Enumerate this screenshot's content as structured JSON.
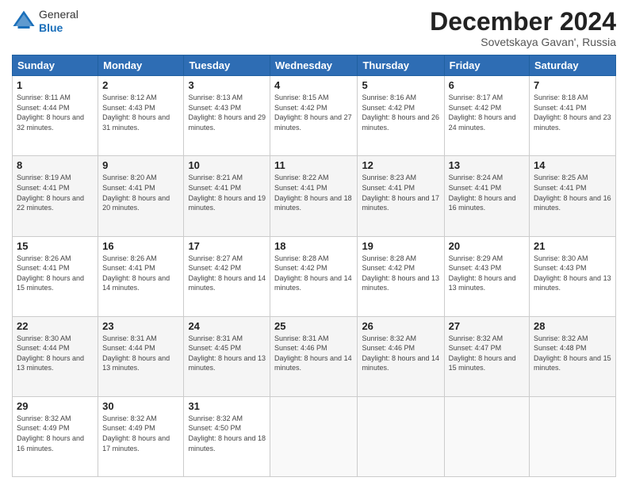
{
  "header": {
    "logo_general": "General",
    "logo_blue": "Blue",
    "month_title": "December 2024",
    "subtitle": "Sovetskaya Gavan', Russia"
  },
  "weekdays": [
    "Sunday",
    "Monday",
    "Tuesday",
    "Wednesday",
    "Thursday",
    "Friday",
    "Saturday"
  ],
  "weeks": [
    [
      {
        "day": "1",
        "sunrise": "8:11 AM",
        "sunset": "4:44 PM",
        "daylight": "8 hours and 32 minutes."
      },
      {
        "day": "2",
        "sunrise": "8:12 AM",
        "sunset": "4:43 PM",
        "daylight": "8 hours and 31 minutes."
      },
      {
        "day": "3",
        "sunrise": "8:13 AM",
        "sunset": "4:43 PM",
        "daylight": "8 hours and 29 minutes."
      },
      {
        "day": "4",
        "sunrise": "8:15 AM",
        "sunset": "4:42 PM",
        "daylight": "8 hours and 27 minutes."
      },
      {
        "day": "5",
        "sunrise": "8:16 AM",
        "sunset": "4:42 PM",
        "daylight": "8 hours and 26 minutes."
      },
      {
        "day": "6",
        "sunrise": "8:17 AM",
        "sunset": "4:42 PM",
        "daylight": "8 hours and 24 minutes."
      },
      {
        "day": "7",
        "sunrise": "8:18 AM",
        "sunset": "4:41 PM",
        "daylight": "8 hours and 23 minutes."
      }
    ],
    [
      {
        "day": "8",
        "sunrise": "8:19 AM",
        "sunset": "4:41 PM",
        "daylight": "8 hours and 22 minutes."
      },
      {
        "day": "9",
        "sunrise": "8:20 AM",
        "sunset": "4:41 PM",
        "daylight": "8 hours and 20 minutes."
      },
      {
        "day": "10",
        "sunrise": "8:21 AM",
        "sunset": "4:41 PM",
        "daylight": "8 hours and 19 minutes."
      },
      {
        "day": "11",
        "sunrise": "8:22 AM",
        "sunset": "4:41 PM",
        "daylight": "8 hours and 18 minutes."
      },
      {
        "day": "12",
        "sunrise": "8:23 AM",
        "sunset": "4:41 PM",
        "daylight": "8 hours and 17 minutes."
      },
      {
        "day": "13",
        "sunrise": "8:24 AM",
        "sunset": "4:41 PM",
        "daylight": "8 hours and 16 minutes."
      },
      {
        "day": "14",
        "sunrise": "8:25 AM",
        "sunset": "4:41 PM",
        "daylight": "8 hours and 16 minutes."
      }
    ],
    [
      {
        "day": "15",
        "sunrise": "8:26 AM",
        "sunset": "4:41 PM",
        "daylight": "8 hours and 15 minutes."
      },
      {
        "day": "16",
        "sunrise": "8:26 AM",
        "sunset": "4:41 PM",
        "daylight": "8 hours and 14 minutes."
      },
      {
        "day": "17",
        "sunrise": "8:27 AM",
        "sunset": "4:42 PM",
        "daylight": "8 hours and 14 minutes."
      },
      {
        "day": "18",
        "sunrise": "8:28 AM",
        "sunset": "4:42 PM",
        "daylight": "8 hours and 14 minutes."
      },
      {
        "day": "19",
        "sunrise": "8:28 AM",
        "sunset": "4:42 PM",
        "daylight": "8 hours and 13 minutes."
      },
      {
        "day": "20",
        "sunrise": "8:29 AM",
        "sunset": "4:43 PM",
        "daylight": "8 hours and 13 minutes."
      },
      {
        "day": "21",
        "sunrise": "8:30 AM",
        "sunset": "4:43 PM",
        "daylight": "8 hours and 13 minutes."
      }
    ],
    [
      {
        "day": "22",
        "sunrise": "8:30 AM",
        "sunset": "4:44 PM",
        "daylight": "8 hours and 13 minutes."
      },
      {
        "day": "23",
        "sunrise": "8:31 AM",
        "sunset": "4:44 PM",
        "daylight": "8 hours and 13 minutes."
      },
      {
        "day": "24",
        "sunrise": "8:31 AM",
        "sunset": "4:45 PM",
        "daylight": "8 hours and 13 minutes."
      },
      {
        "day": "25",
        "sunrise": "8:31 AM",
        "sunset": "4:46 PM",
        "daylight": "8 hours and 14 minutes."
      },
      {
        "day": "26",
        "sunrise": "8:32 AM",
        "sunset": "4:46 PM",
        "daylight": "8 hours and 14 minutes."
      },
      {
        "day": "27",
        "sunrise": "8:32 AM",
        "sunset": "4:47 PM",
        "daylight": "8 hours and 15 minutes."
      },
      {
        "day": "28",
        "sunrise": "8:32 AM",
        "sunset": "4:48 PM",
        "daylight": "8 hours and 15 minutes."
      }
    ],
    [
      {
        "day": "29",
        "sunrise": "8:32 AM",
        "sunset": "4:49 PM",
        "daylight": "8 hours and 16 minutes."
      },
      {
        "day": "30",
        "sunrise": "8:32 AM",
        "sunset": "4:49 PM",
        "daylight": "8 hours and 17 minutes."
      },
      {
        "day": "31",
        "sunrise": "8:32 AM",
        "sunset": "4:50 PM",
        "daylight": "8 hours and 18 minutes."
      },
      null,
      null,
      null,
      null
    ]
  ]
}
